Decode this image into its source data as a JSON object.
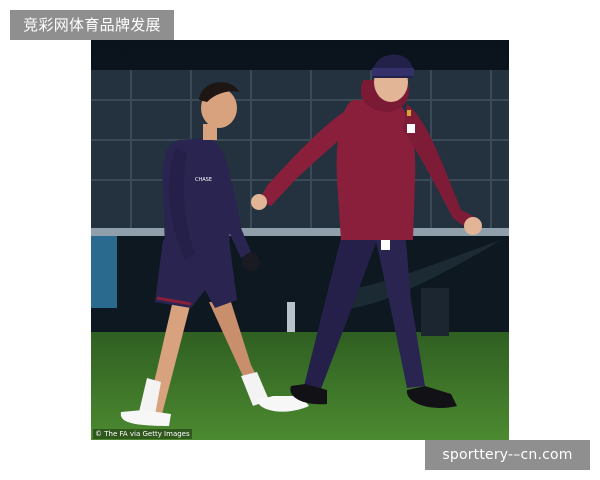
{
  "header": {
    "tag_text": "竞彩网体育品牌发展"
  },
  "photo": {
    "credit": "© The FA via Getty Images",
    "shirt_sponsor": "CHASE"
  },
  "footer": {
    "tag_text": "sporttery-–cn.com"
  },
  "colors": {
    "tag_background": "#8f8f8f",
    "tag_text": "#ffffff",
    "kit_navy": "#2a2550",
    "jacket_maroon": "#8a1f3c",
    "pitch_green": "#3f7a2a"
  }
}
